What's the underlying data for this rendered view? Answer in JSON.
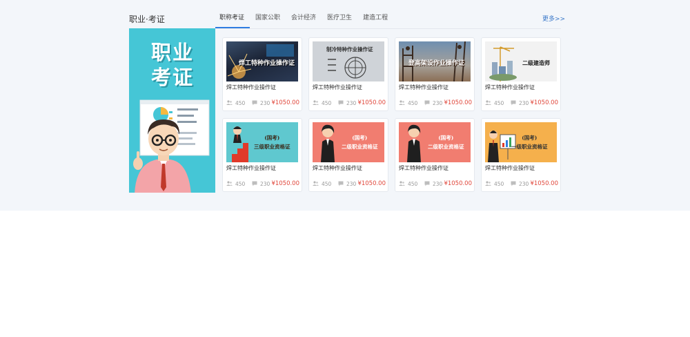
{
  "section": {
    "title": "职业·考证",
    "more": "更多>>"
  },
  "tabs": [
    "职称考证",
    "国家公职",
    "会计经济",
    "医疗卫生",
    "建造工程"
  ],
  "banner": {
    "line1": "职业",
    "line2": "考证"
  },
  "colors": {
    "accent": "#2f7de1",
    "price": "#e0463a",
    "banner": "#45c6d6",
    "link": "#3a78c9"
  },
  "cards": [
    {
      "thumb_text": "焊工特种作业操作证",
      "title": "焊工特种作业操作证",
      "students": "450",
      "comments": "230",
      "price": "¥1050.00"
    },
    {
      "thumb_text": "制冷特种作业操作证",
      "title": "焊工特种作业操作证",
      "students": "450",
      "comments": "230",
      "price": "¥1050.00"
    },
    {
      "thumb_text": "登高架设作业操作证",
      "title": "焊工特种作业操作证",
      "students": "450",
      "comments": "230",
      "price": "¥1050.00"
    },
    {
      "thumb_text": "二级建造师",
      "title": "焊工特种作业操作证",
      "students": "450",
      "comments": "230",
      "price": "¥1050.00"
    },
    {
      "thumb_text": [
        "(国考)",
        "三级职业资格证"
      ],
      "title": "焊工特种作业操作证",
      "students": "450",
      "comments": "230",
      "price": "¥1050.00"
    },
    {
      "thumb_text": [
        "(国考)",
        "二级职业资格证"
      ],
      "title": "焊工特种作业操作证",
      "students": "450",
      "comments": "230",
      "price": "¥1050.00"
    },
    {
      "thumb_text": [
        "(国考)",
        "二级职业资格证"
      ],
      "title": "焊工特种作业操作证",
      "students": "450",
      "comments": "230",
      "price": "¥1050.00"
    },
    {
      "thumb_text": [
        "(国考)",
        "一级职业资格证"
      ],
      "title": "焊工特种作业操作证",
      "students": "450",
      "comments": "230",
      "price": "¥1050.00"
    }
  ]
}
